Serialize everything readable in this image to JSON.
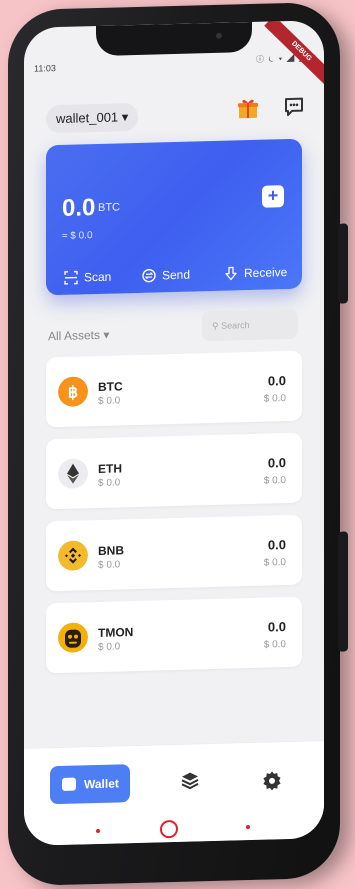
{
  "status": {
    "time": "11:03",
    "icons": "ⓘ ⏾ ▾ ◢ ◢ ▮"
  },
  "debug_ribbon": "DEBUG",
  "header": {
    "wallet_name": "wallet_001 ▾"
  },
  "card": {
    "balance": "0.0",
    "unit": "BTC",
    "fiat": "≈ $ 0.0",
    "add_symbol": "+",
    "actions": {
      "scan": "Scan",
      "send": "Send",
      "receive": "Receive"
    }
  },
  "assets": {
    "filter_label": "All Assets ▾",
    "search_placeholder": "Search",
    "items": [
      {
        "symbol": "BTC",
        "fiat": "$ 0.0",
        "amount": "0.0",
        "usd": "$ 0.0",
        "color": "#f7931a"
      },
      {
        "symbol": "ETH",
        "fiat": "$ 0.0",
        "amount": "0.0",
        "usd": "$ 0.0",
        "color": "#ececf0"
      },
      {
        "symbol": "BNB",
        "fiat": "$ 0.0",
        "amount": "0.0",
        "usd": "$ 0.0",
        "color": "#f3ba2f"
      },
      {
        "symbol": "TMON",
        "fiat": "$ 0.0",
        "amount": "0.0",
        "usd": "$ 0.0",
        "color": "#f2b10a"
      }
    ]
  },
  "bottom_nav": {
    "wallet_label": "Wallet",
    "accent": "#4e7ef3"
  }
}
